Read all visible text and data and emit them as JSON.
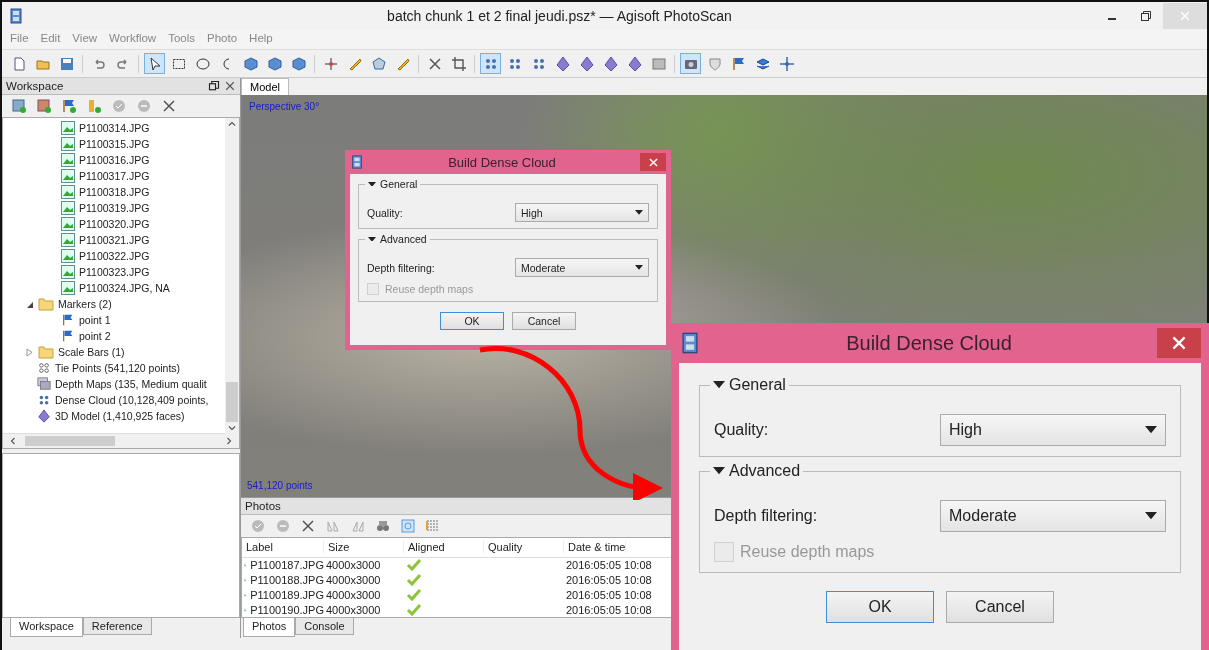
{
  "window": {
    "title": "batch chunk 1 et 2 final jeudi.psz* — Agisoft PhotoScan"
  },
  "menu": [
    "File",
    "Edit",
    "View",
    "Workflow",
    "Tools",
    "Photo",
    "Help"
  ],
  "toolbar": [
    {
      "selected": false
    },
    {
      "selected": false
    },
    {
      "selected": false
    },
    {
      "selected": false
    },
    {
      "selected": false
    },
    {
      "selected": true
    },
    {
      "selected": false
    },
    {
      "selected": false
    },
    {
      "selected": false
    },
    {
      "selected": false
    },
    {
      "selected": false
    },
    {
      "selected": false
    },
    {
      "selected": false
    },
    {
      "selected": false
    },
    {
      "selected": false
    },
    {
      "selected": false
    },
    {
      "selected": false
    },
    {
      "selected": false
    },
    {
      "selected": true
    },
    {
      "selected": false
    },
    {
      "selected": false
    },
    {
      "selected": false
    },
    {
      "selected": false
    },
    {
      "selected": false
    },
    {
      "selected": false
    },
    {
      "selected": false
    },
    {
      "selected": true
    },
    {
      "selected": false
    },
    {
      "selected": false
    },
    {
      "selected": false
    },
    {
      "selected": false
    }
  ],
  "workspace": {
    "title": "Workspace",
    "tree": [
      {
        "kind": "camera",
        "label": "P1100314.JPG"
      },
      {
        "kind": "camera",
        "label": "P1100315.JPG"
      },
      {
        "kind": "camera",
        "label": "P1100316.JPG"
      },
      {
        "kind": "camera",
        "label": "P1100317.JPG"
      },
      {
        "kind": "camera",
        "label": "P1100318.JPG"
      },
      {
        "kind": "camera",
        "label": "P1100319.JPG"
      },
      {
        "kind": "camera",
        "label": "P1100320.JPG"
      },
      {
        "kind": "camera",
        "label": "P1100321.JPG"
      },
      {
        "kind": "camera",
        "label": "P1100322.JPG"
      },
      {
        "kind": "camera",
        "label": "P1100323.JPG"
      },
      {
        "kind": "camera",
        "label": "P1100324.JPG, NA"
      },
      {
        "kind": "folder",
        "label": "Markers (2)",
        "expanded": true,
        "children": [
          {
            "kind": "marker",
            "label": "point 1"
          },
          {
            "kind": "marker",
            "label": "point 2"
          }
        ]
      },
      {
        "kind": "folder",
        "label": "Scale Bars (1)",
        "expanded": false
      },
      {
        "kind": "tie_points",
        "label": "Tie Points (541,120 points)"
      },
      {
        "kind": "depth_maps",
        "label": "Depth Maps (135, Medium qualit"
      },
      {
        "kind": "dense_cloud",
        "label": "Dense Cloud (10,128,409 points,"
      },
      {
        "kind": "model",
        "label": "3D Model (1,410,925 faces)"
      }
    ],
    "tabs": [
      {
        "label": "Workspace",
        "selected": true
      },
      {
        "label": "Reference",
        "selected": false
      }
    ]
  },
  "model": {
    "tab": "Model",
    "view_label": "Perspective 30°",
    "points_label": "541,120 points"
  },
  "photos": {
    "title": "Photos",
    "columns": [
      "Label",
      "Size",
      "Aligned",
      "Quality",
      "Date & time"
    ],
    "rows": [
      {
        "label": "P1100187.JPG",
        "size": "4000x3000",
        "aligned": true,
        "date": "2016:05:05 10:08"
      },
      {
        "label": "P1100188.JPG",
        "size": "4000x3000",
        "aligned": true,
        "date": "2016:05:05 10:08"
      },
      {
        "label": "P1100189.JPG",
        "size": "4000x3000",
        "aligned": true,
        "date": "2016:05:05 10:08"
      },
      {
        "label": "P1100190.JPG",
        "size": "4000x3000",
        "aligned": true,
        "date": "2016:05:05 10:08"
      }
    ],
    "tabs": [
      {
        "label": "Photos",
        "selected": true
      },
      {
        "label": "Console",
        "selected": false
      }
    ]
  },
  "dialogs": [
    {
      "title": "Build Dense Cloud",
      "general": "General",
      "quality_label": "Quality:",
      "quality": "High",
      "advanced": "Advanced",
      "depth_label": "Depth filtering:",
      "depth": "Moderate",
      "reuse": "Reuse depth maps",
      "reuse_checked": false,
      "reuse_disabled": true,
      "ok": "OK",
      "cancel": "Cancel"
    },
    {
      "title": "Build Dense Cloud",
      "general": "General",
      "quality_label": "Quality:",
      "quality": "High",
      "advanced": "Advanced",
      "depth_label": "Depth filtering:",
      "depth": "Moderate",
      "reuse": "Reuse depth maps",
      "reuse_checked": false,
      "reuse_disabled": true,
      "ok": "OK",
      "cancel": "Cancel"
    }
  ]
}
